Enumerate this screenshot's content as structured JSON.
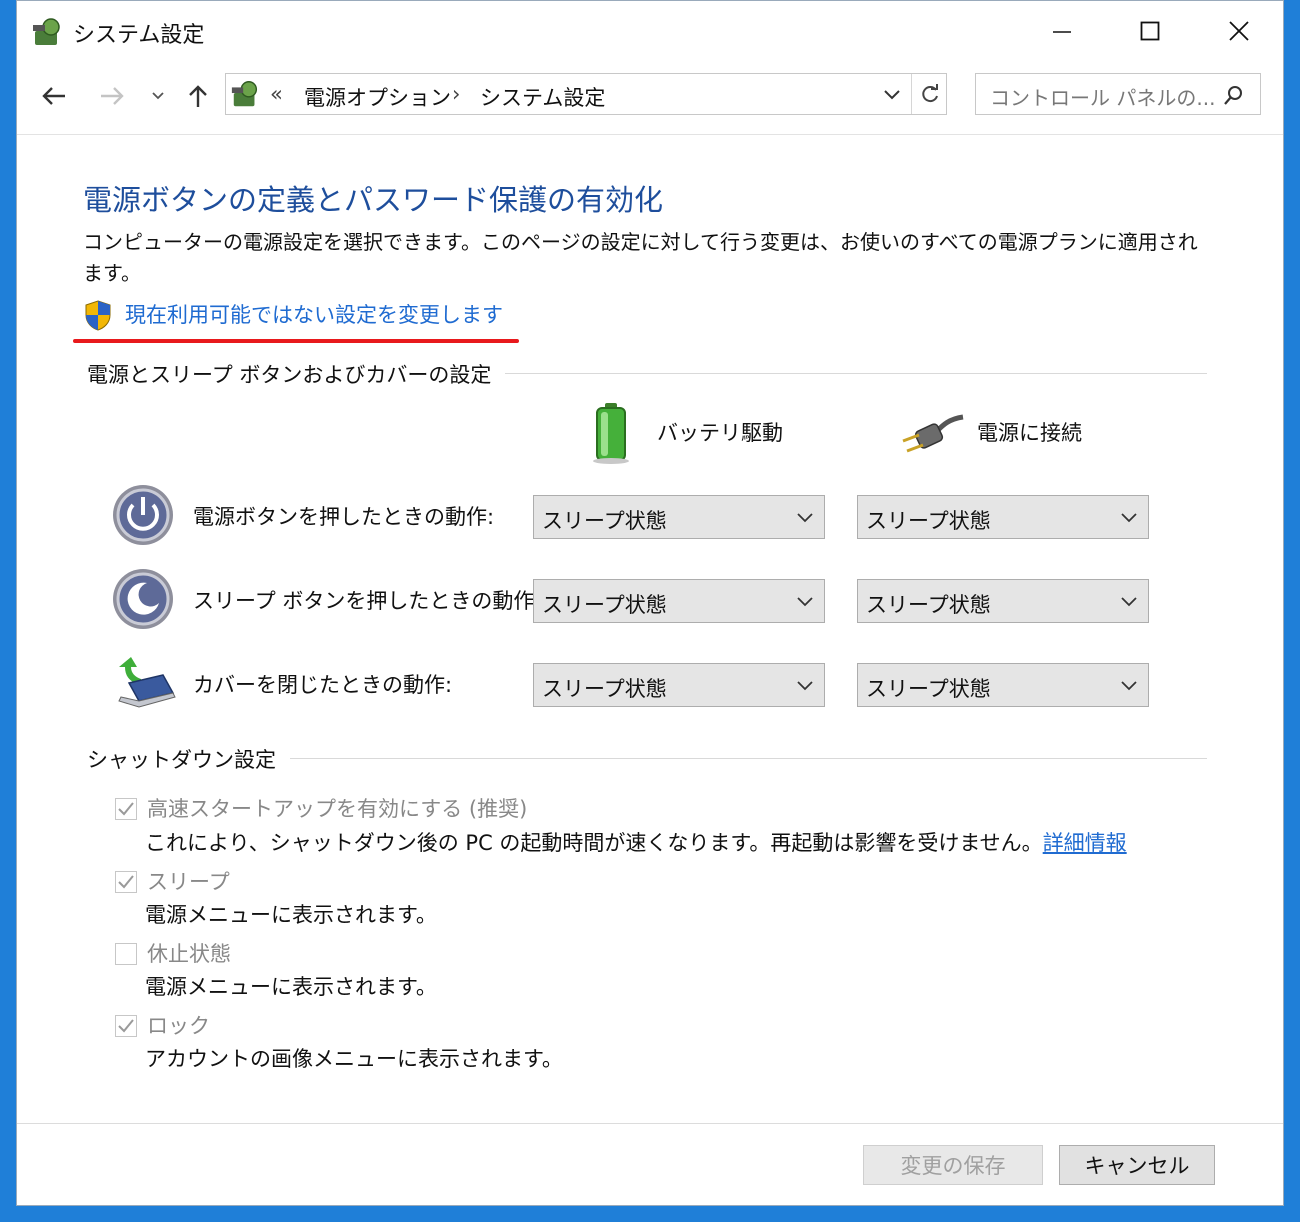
{
  "window": {
    "title": "システム設定"
  },
  "nav": {
    "breadcrumb_prefix": "«",
    "breadcrumb": [
      "電源オプション",
      "システム設定"
    ],
    "breadcrumb_sep": "›",
    "search_placeholder": "コントロール パネルの..."
  },
  "page": {
    "heading": "電源ボタンの定義とパスワード保護の有効化",
    "description": "コンピューターの電源設定を選択できます。このページの設定に対して行う変更は、お使いのすべての電源プランに適用されます。",
    "change_link": "現在利用可能ではない設定を変更します"
  },
  "power_group": {
    "title": "電源とスリープ ボタンおよびカバーの設定",
    "col_battery": "バッテリ駆動",
    "col_plugged": "電源に接続",
    "rows": [
      {
        "label": "電源ボタンを押したときの動作:",
        "battery": "スリープ状態",
        "plugged": "スリープ状態"
      },
      {
        "label": "スリープ ボタンを押したときの動作:",
        "battery": "スリープ状態",
        "plugged": "スリープ状態"
      },
      {
        "label": "カバーを閉じたときの動作:",
        "battery": "スリープ状態",
        "plugged": "スリープ状態"
      }
    ]
  },
  "shutdown_group": {
    "title": "シャットダウン設定",
    "items": [
      {
        "label": "高速スタートアップを有効にする (推奨)",
        "checked": true,
        "description": "これにより、シャットダウン後の PC の起動時間が速くなります。再起動は影響を受けません。",
        "link": "詳細情報"
      },
      {
        "label": "スリープ",
        "checked": true,
        "description": "電源メニューに表示されます。"
      },
      {
        "label": "休止状態",
        "checked": false,
        "description": "電源メニューに表示されます。"
      },
      {
        "label": "ロック",
        "checked": true,
        "description": "アカウントの画像メニューに表示されます。"
      }
    ]
  },
  "footer": {
    "save_label": "変更の保存",
    "cancel_label": "キャンセル"
  },
  "colors": {
    "heading": "#1e4e9c",
    "link": "#1f6bd1",
    "highlight_underline": "#e8191c",
    "desktop": "#1f7fd8"
  }
}
